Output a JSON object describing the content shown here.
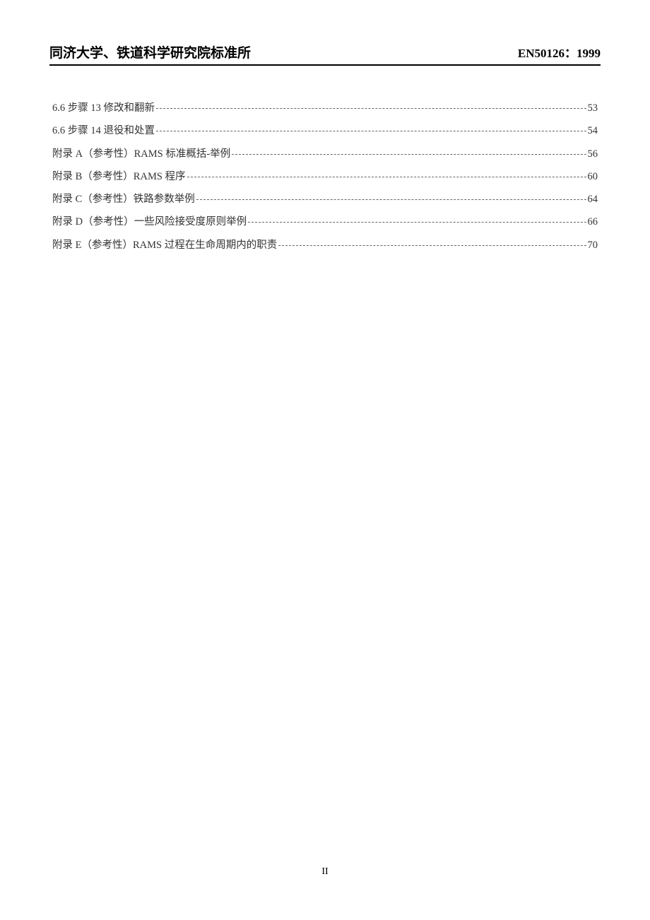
{
  "header": {
    "left": "同济大学、铁道科学研究院标准所",
    "right": "EN50126：1999"
  },
  "toc": {
    "entries": [
      {
        "label": "6.6 步骤 13  修改和翻新",
        "page": "53"
      },
      {
        "label": "6.6 步骤 14  退役和处置",
        "page": "54"
      },
      {
        "label": "附录 A（参考性）RAMS 标准概括-举例",
        "page": "56"
      },
      {
        "label": "附录 B（参考性）RAMS 程序",
        "page": "60"
      },
      {
        "label": "附录 C（参考性）铁路参数举例",
        "page": "64"
      },
      {
        "label": "附录 D（参考性）一些风险接受度原则举例",
        "page": "66"
      },
      {
        "label": "附录 E（参考性）RAMS 过程在生命周期内的职责",
        "page": "70"
      }
    ]
  },
  "footer": {
    "page_number": "II"
  }
}
